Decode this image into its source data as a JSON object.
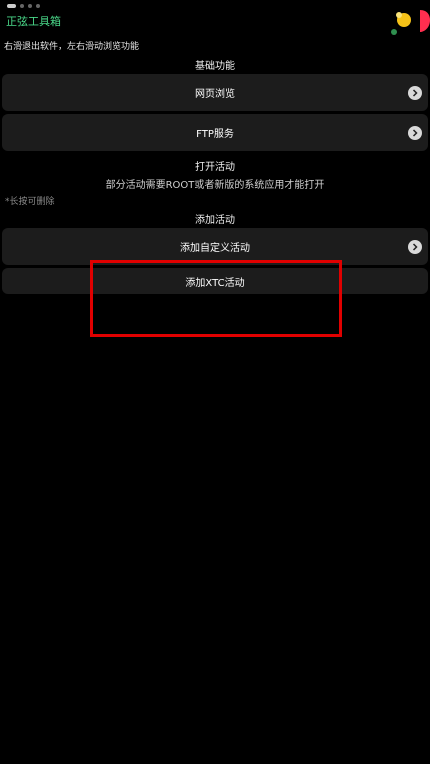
{
  "app_title": "正弦工具箱",
  "hint": "右滑退出软件，左右滑动浏览功能",
  "sections": {
    "basic": {
      "title": "基础功能",
      "items": [
        {
          "label": "网页浏览"
        },
        {
          "label": "FTP服务"
        }
      ]
    },
    "open_activity": {
      "title": "打开活动",
      "subtitle": "部分活动需要ROOT或者新版的系统应用才能打开",
      "note": "*长按可删除"
    },
    "add_activity": {
      "title": "添加活动",
      "items": [
        {
          "label": "添加自定义活动"
        },
        {
          "label": "添加XTC活动"
        }
      ]
    }
  },
  "page_indicator": {
    "count": 4,
    "active": 0
  },
  "colors": {
    "title_green": "#4ad98a",
    "row_bg": "#1c1c1c",
    "highlight_red": "#e00000"
  }
}
